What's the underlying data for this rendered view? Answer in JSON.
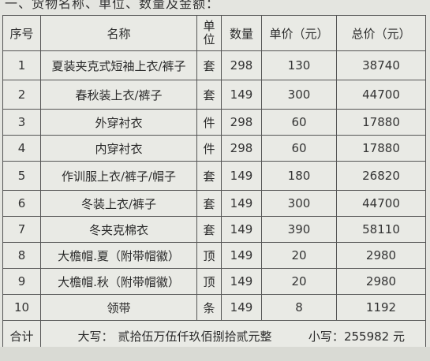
{
  "heading": "一、货物名称、单位、数量及金额：",
  "table": {
    "headers": {
      "seq": "序号",
      "name": "名称",
      "unit_line1": "单",
      "unit_line2": "位",
      "qty": "数量",
      "price": "单价（元）",
      "total": "总价（元）"
    },
    "rows": [
      {
        "seq": "1",
        "name": "夏装夹克式短袖上衣/裤子",
        "unit": "套",
        "qty": "298",
        "price": "130",
        "total": "38740"
      },
      {
        "seq": "2",
        "name": "春秋装上衣/裤子",
        "unit": "套",
        "qty": "149",
        "price": "300",
        "total": "44700"
      },
      {
        "seq": "3",
        "name": "外穿衬衣",
        "unit": "件",
        "qty": "298",
        "price": "60",
        "total": "17880"
      },
      {
        "seq": "4",
        "name": "内穿衬衣",
        "unit": "件",
        "qty": "298",
        "price": "60",
        "total": "17880"
      },
      {
        "seq": "5",
        "name": "作训服上衣/裤子/帽子",
        "unit": "套",
        "qty": "149",
        "price": "180",
        "total": "26820"
      },
      {
        "seq": "6",
        "name": "冬装上衣/裤子",
        "unit": "套",
        "qty": "149",
        "price": "300",
        "total": "44700"
      },
      {
        "seq": "7",
        "name": "冬夹克棉衣",
        "unit": "套",
        "qty": "149",
        "price": "390",
        "total": "58110"
      },
      {
        "seq": "8",
        "name": "大檐帽.夏（附带帽徽）",
        "unit": "顶",
        "qty": "149",
        "price": "20",
        "total": "2980"
      },
      {
        "seq": "9",
        "name": "大檐帽.秋（附带帽徽）",
        "unit": "顶",
        "qty": "149",
        "price": "20",
        "total": "2980"
      },
      {
        "seq": "10",
        "name": "领带",
        "unit": "条",
        "qty": "149",
        "price": "8",
        "total": "1192"
      }
    ],
    "total_row": {
      "label": "合计",
      "upper_label": "大写：",
      "upper_amount": "贰拾伍万伍仟玖佰捌拾贰元整",
      "lower_label": "小写：",
      "lower_amount": "255982",
      "lower_unit": "元"
    }
  }
}
